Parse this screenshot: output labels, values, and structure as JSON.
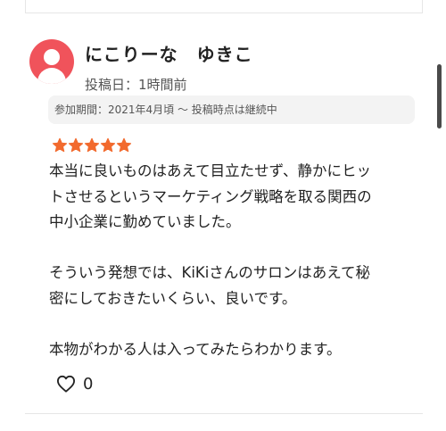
{
  "review": {
    "author_name": "にこりーな　ゆきこ",
    "posted_label": "投稿日：1時間前",
    "period_label": "参加期間：2021年4月頃 〜 投稿時点は継続中",
    "rating": 5,
    "rating_max": 5,
    "star_color": "#f26a2e",
    "paragraphs": [
      [
        "本当に良いものはあえて目立たせず、静かにヒッ",
        "トさせるというマーケティング戦略を取る関西の",
        "中小企業に勤めていました。"
      ],
      [
        "そういう発想では、KiKiさんのサロンはあえて秘",
        "密にしておきたいくらい、良いです。"
      ],
      [
        "本物がわかる人は入ってみたらわかります。"
      ]
    ],
    "like_count": "0"
  },
  "colors": {
    "avatar": "#f0535b",
    "divider": "#e6e6e6",
    "period_bg": "#f3f3f3"
  },
  "icons": {
    "avatar": "user-avatar-icon",
    "star": "star-icon",
    "like": "heart-outline-icon"
  }
}
